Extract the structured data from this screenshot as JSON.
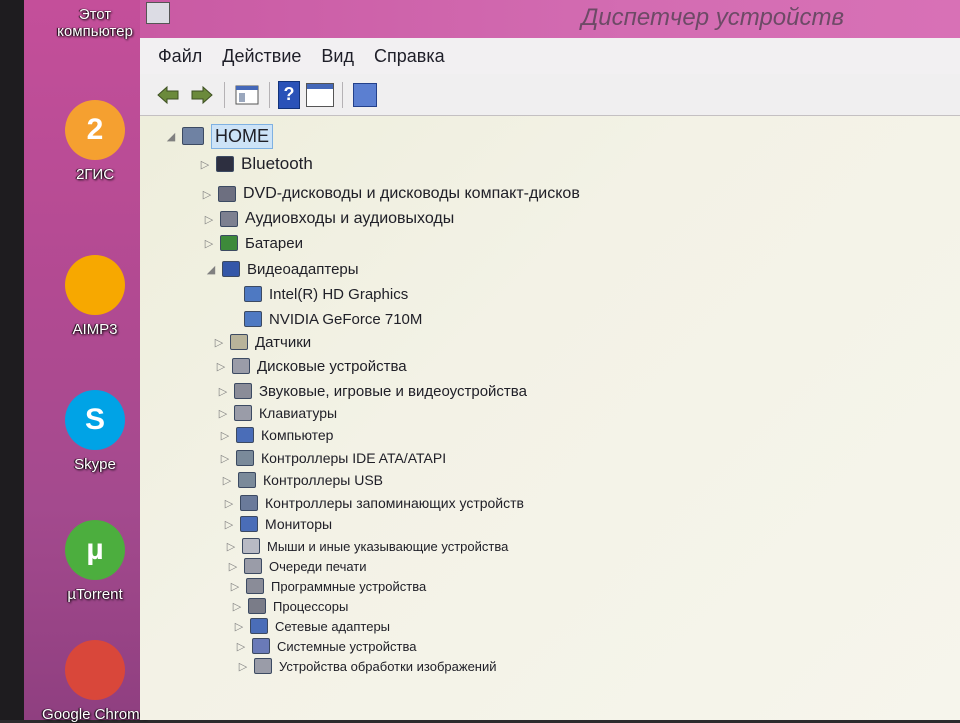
{
  "desktop": {
    "icons": [
      {
        "label": "Этот компьютер",
        "icon": "computer-icon",
        "color": "#3a70c8"
      },
      {
        "label": "2ГИС",
        "icon": "2gis-icon",
        "color": "#f5a030",
        "badge": "2"
      },
      {
        "label": "AIMP3",
        "icon": "aimp-icon",
        "color": "#f7a800"
      },
      {
        "label": "Skype",
        "icon": "skype-icon",
        "color": "#00a3e6",
        "glyph": "S"
      },
      {
        "label": "µTorrent",
        "icon": "utorrent-icon",
        "color": "#4cae3e",
        "glyph": "µ"
      },
      {
        "label": "Google Chrome",
        "icon": "chrome-icon",
        "color": "#d9473a"
      }
    ]
  },
  "window": {
    "title": "Диспетчер устройств",
    "menu": [
      "Файл",
      "Действие",
      "Вид",
      "Справка"
    ],
    "toolbar": {
      "back": "back-arrow-icon",
      "forward": "forward-arrow-icon",
      "show_hide": "console-tree-icon",
      "help": "?",
      "properties": "properties-icon",
      "scan": "scan-hardware-icon"
    }
  },
  "tree": {
    "root": "HOME",
    "expanded_category": "Видеоадаптеры",
    "items": [
      {
        "label": "Bluetooth",
        "level": 1
      },
      {
        "label": "DVD-дисководы и дисководы компакт-дисков",
        "level": 1
      },
      {
        "label": "Аудиовходы и аудиовыходы",
        "level": 1
      },
      {
        "label": "Батареи",
        "level": 1
      },
      {
        "label": "Видеоадаптеры",
        "level": 1,
        "expanded": true
      },
      {
        "label": "Intel(R) HD Graphics",
        "level": 2
      },
      {
        "label": "NVIDIA GeForce 710M",
        "level": 2
      },
      {
        "label": "Датчики",
        "level": 1
      },
      {
        "label": "Дисковые устройства",
        "level": 1
      },
      {
        "label": "Звуковые, игровые и видеоустройства",
        "level": 1
      },
      {
        "label": "Клавиатуры",
        "level": 1
      },
      {
        "label": "Компьютер",
        "level": 1
      },
      {
        "label": "Контроллеры IDE ATA/ATAPI",
        "level": 1
      },
      {
        "label": "Контроллеры USB",
        "level": 1
      },
      {
        "label": "Контроллеры запоминающих устройств",
        "level": 1
      },
      {
        "label": "Мониторы",
        "level": 1
      },
      {
        "label": "Мыши и иные указывающие устройства",
        "level": 1
      },
      {
        "label": "Очереди печати",
        "level": 1
      },
      {
        "label": "Программные устройства",
        "level": 1
      },
      {
        "label": "Процессоры",
        "level": 1
      },
      {
        "label": "Сетевые адаптеры",
        "level": 1
      },
      {
        "label": "Системные устройства",
        "level": 1
      },
      {
        "label": "Устройства обработки изображений",
        "level": 1
      }
    ]
  },
  "colors": {
    "window_title_bar": "#d36cb2",
    "selection": "#cde3f7",
    "tree_background": "#f3f2e6"
  }
}
